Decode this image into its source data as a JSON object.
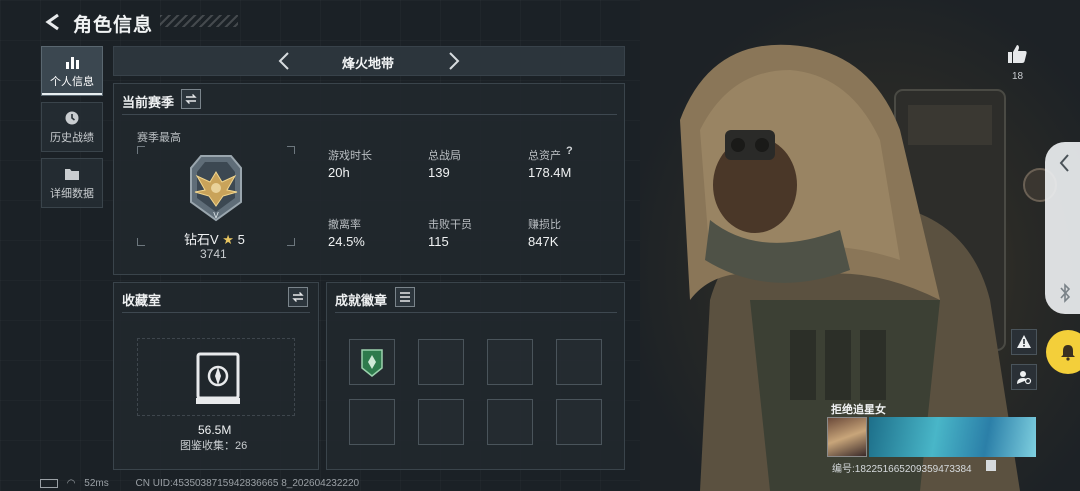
{
  "header": {
    "title": "角色信息"
  },
  "nav": [
    {
      "label": "个人信息",
      "icon": "bar-chart-icon",
      "active": true
    },
    {
      "label": "历史战绩",
      "icon": "history-icon",
      "active": false
    },
    {
      "label": "详细数据",
      "icon": "folder-icon",
      "active": false
    }
  ],
  "season": {
    "name": "烽火地带"
  },
  "current_season": {
    "title": "当前赛季",
    "best_label": "赛季最高",
    "rank_name": "钻石V",
    "rank_stars": "5",
    "rank_score": "3741",
    "stats": [
      {
        "label": "游戏时长",
        "value": "20h"
      },
      {
        "label": "总战局",
        "value": "139"
      },
      {
        "label": "总资产",
        "value": "178.4M",
        "help": "?"
      },
      {
        "label": "撤离率",
        "value": "24.5%"
      },
      {
        "label": "击败干员",
        "value": "115"
      },
      {
        "label": "赚损比",
        "value": "847K"
      }
    ]
  },
  "collection": {
    "title": "收藏室",
    "value": "56.5M",
    "count_label": "图鉴收集：26"
  },
  "badges": {
    "title": "成就徽章"
  },
  "right": {
    "likes": "18",
    "player_name": "拒绝追星女",
    "player_id": "编号:182251665209359473384"
  },
  "footer": {
    "ping": "52ms",
    "uid": "CN UID:4535038715942836665 8_202604232220"
  },
  "colors": {
    "accent_yellow": "#f3cf3a",
    "badge_green": "#2e7a4c"
  }
}
